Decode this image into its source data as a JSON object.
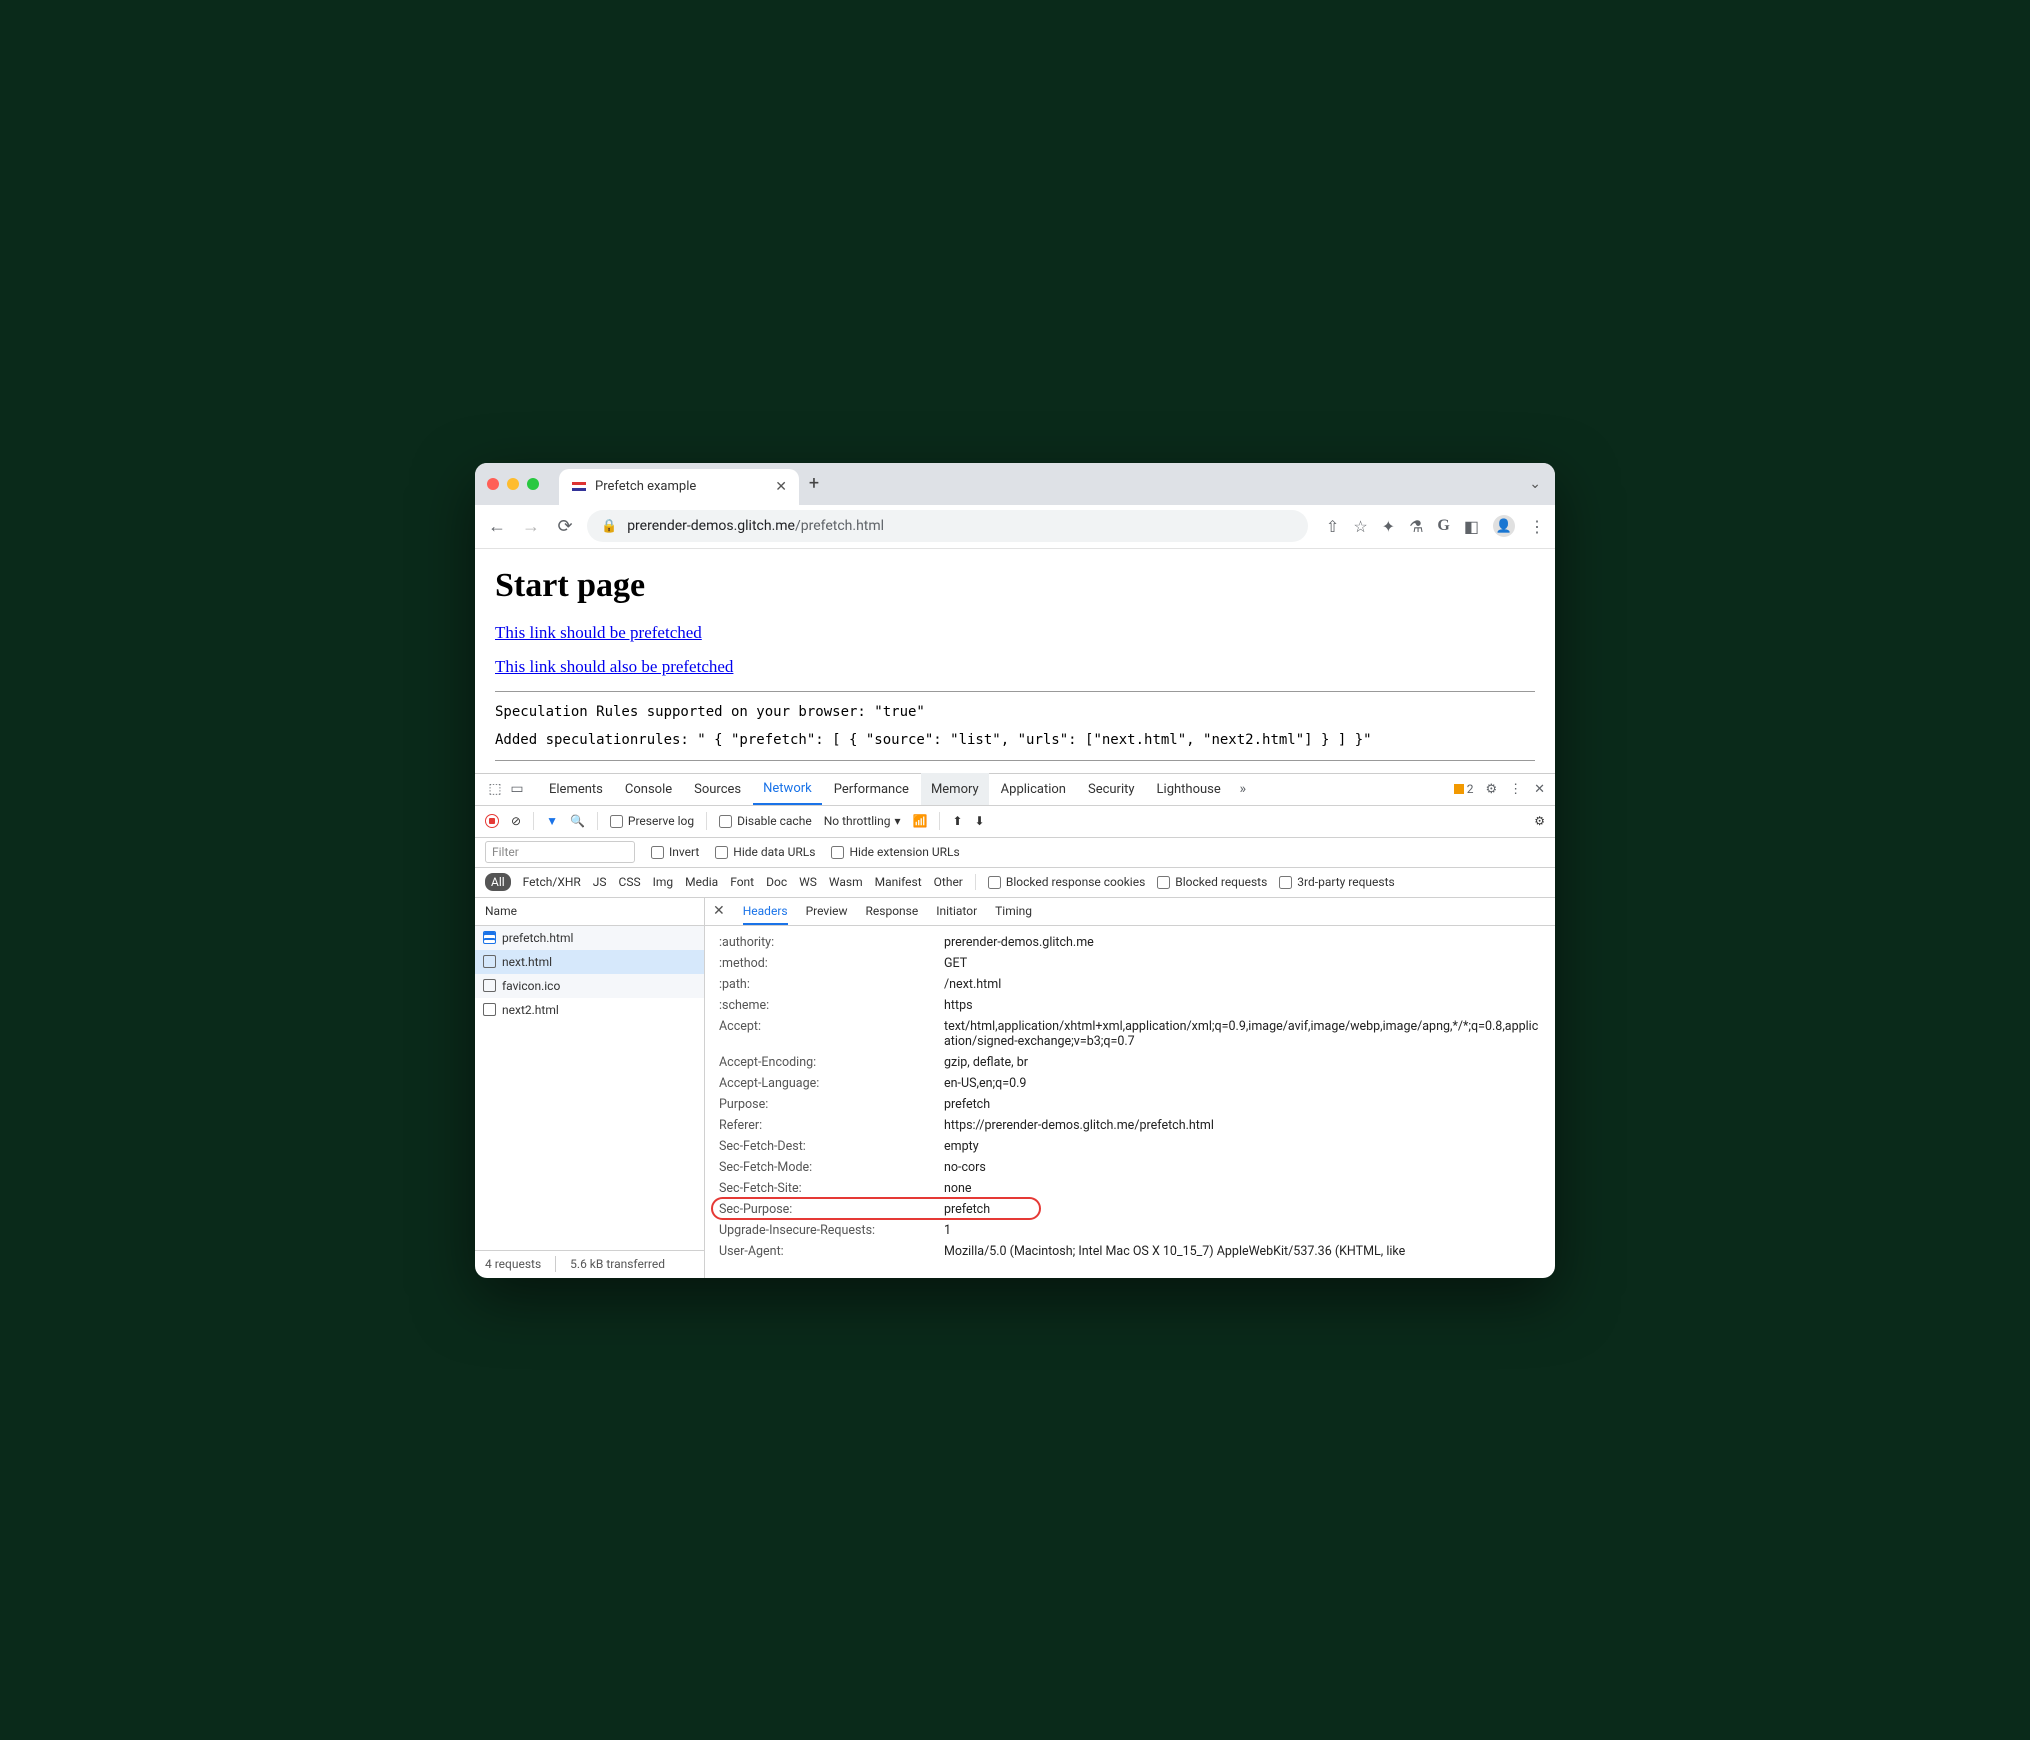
{
  "browser": {
    "tab_title": "Prefetch example",
    "url_host": "prerender-demos.glitch.me",
    "url_path": "/prefetch.html"
  },
  "page": {
    "heading": "Start page",
    "link1": "This link should be prefetched",
    "link2": "This link should also be prefetched",
    "mono1": "Speculation Rules supported on your browser: \"true\"",
    "mono2": "Added speculationrules: \" { \"prefetch\": [ { \"source\": \"list\", \"urls\": [\"next.html\", \"next2.html\"] } ] }\""
  },
  "devtools": {
    "tabs": [
      "Elements",
      "Console",
      "Sources",
      "Network",
      "Performance",
      "Memory",
      "Application",
      "Security",
      "Lighthouse"
    ],
    "warn_count": "2",
    "toolbar": {
      "preserve": "Preserve log",
      "disable_cache": "Disable cache",
      "throttling": "No throttling"
    },
    "filter_placeholder": "Filter",
    "filters": {
      "invert": "Invert",
      "hide_data": "Hide data URLs",
      "hide_ext": "Hide extension URLs"
    },
    "types": [
      "All",
      "Fetch/XHR",
      "JS",
      "CSS",
      "Img",
      "Media",
      "Font",
      "Doc",
      "WS",
      "Wasm",
      "Manifest",
      "Other"
    ],
    "type_checks": {
      "blocked_cookies": "Blocked response cookies",
      "blocked_req": "Blocked requests",
      "third": "3rd-party requests"
    },
    "name_header": "Name",
    "requests": [
      {
        "name": "prefetch.html",
        "icon": "doc"
      },
      {
        "name": "next.html",
        "icon": "box",
        "selected": true
      },
      {
        "name": "favicon.ico",
        "icon": "box"
      },
      {
        "name": "next2.html",
        "icon": "box"
      }
    ],
    "detail_tabs": [
      "Headers",
      "Preview",
      "Response",
      "Initiator",
      "Timing"
    ],
    "headers": [
      {
        "k": ":authority:",
        "v": "prerender-demos.glitch.me"
      },
      {
        "k": ":method:",
        "v": "GET"
      },
      {
        "k": ":path:",
        "v": "/next.html"
      },
      {
        "k": ":scheme:",
        "v": "https"
      },
      {
        "k": "Accept:",
        "v": "text/html,application/xhtml+xml,application/xml;q=0.9,image/avif,image/webp,image/apng,*/*;q=0.8,application/signed-exchange;v=b3;q=0.7"
      },
      {
        "k": "Accept-Encoding:",
        "v": "gzip, deflate, br"
      },
      {
        "k": "Accept-Language:",
        "v": "en-US,en;q=0.9"
      },
      {
        "k": "Purpose:",
        "v": "prefetch"
      },
      {
        "k": "Referer:",
        "v": "https://prerender-demos.glitch.me/prefetch.html"
      },
      {
        "k": "Sec-Fetch-Dest:",
        "v": "empty"
      },
      {
        "k": "Sec-Fetch-Mode:",
        "v": "no-cors"
      },
      {
        "k": "Sec-Fetch-Site:",
        "v": "none"
      },
      {
        "k": "Sec-Purpose:",
        "v": "prefetch",
        "hl": true
      },
      {
        "k": "Upgrade-Insecure-Requests:",
        "v": "1"
      },
      {
        "k": "User-Agent:",
        "v": "Mozilla/5.0 (Macintosh; Intel Mac OS X 10_15_7) AppleWebKit/537.36 (KHTML, like"
      }
    ],
    "footer": {
      "requests": "4 requests",
      "transferred": "5.6 kB transferred"
    }
  }
}
